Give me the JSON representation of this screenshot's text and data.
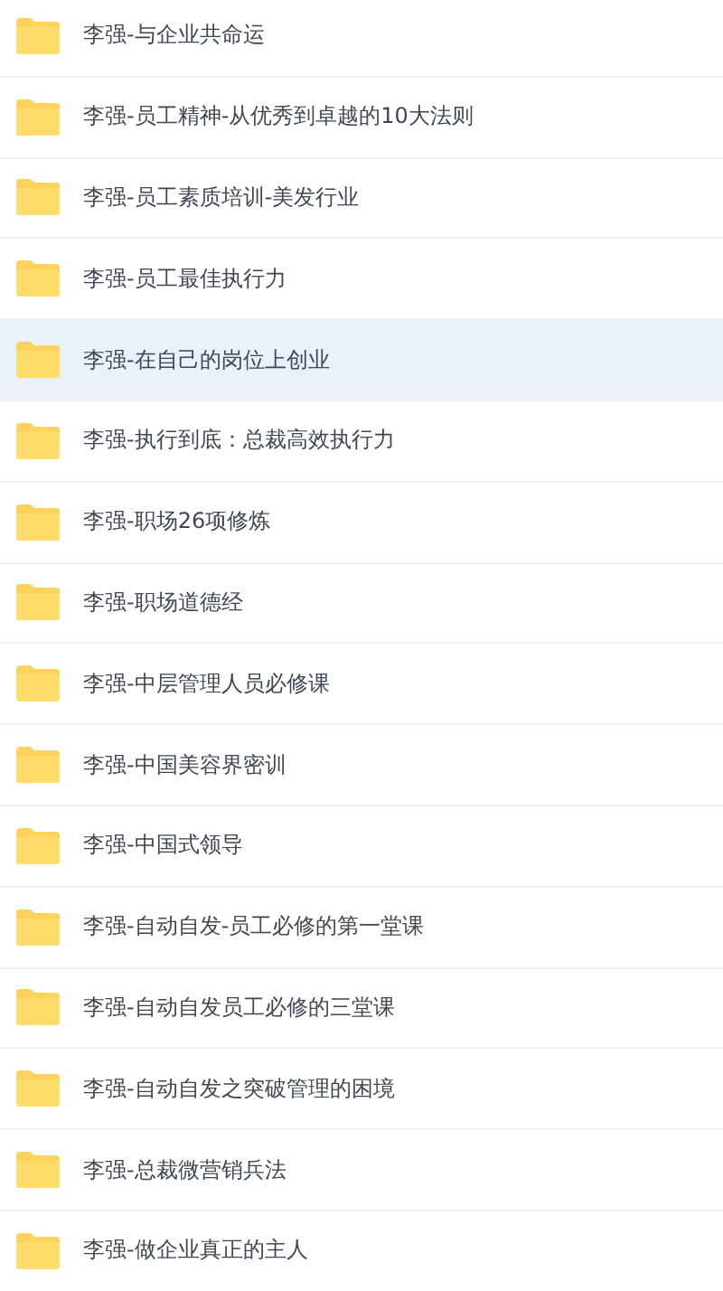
{
  "folders": [
    {
      "name": "李强-与企业共命运",
      "selected": false
    },
    {
      "name": "李强-员工精神-从优秀到卓越的10大法则",
      "selected": false
    },
    {
      "name": "李强-员工素质培训-美发行业",
      "selected": false
    },
    {
      "name": "李强-员工最佳执行力",
      "selected": false
    },
    {
      "name": "李强-在自己的岗位上创业",
      "selected": true
    },
    {
      "name": "李强-执行到底：总裁高效执行力",
      "selected": false
    },
    {
      "name": "李强-职场26项修炼",
      "selected": false
    },
    {
      "name": "李强-职场道德经",
      "selected": false
    },
    {
      "name": "李强-中层管理人员必修课",
      "selected": false
    },
    {
      "name": "李强-中国美容界密训",
      "selected": false
    },
    {
      "name": "李强-中国式领导",
      "selected": false
    },
    {
      "name": "李强-自动自发-员工必修的第一堂课",
      "selected": false
    },
    {
      "name": "李强-自动自发员工必修的三堂课",
      "selected": false
    },
    {
      "name": "李强-自动自发之突破管理的困境",
      "selected": false
    },
    {
      "name": "李强-总裁微营销兵法",
      "selected": false
    },
    {
      "name": "李强-做企业真正的主人",
      "selected": false
    }
  ]
}
